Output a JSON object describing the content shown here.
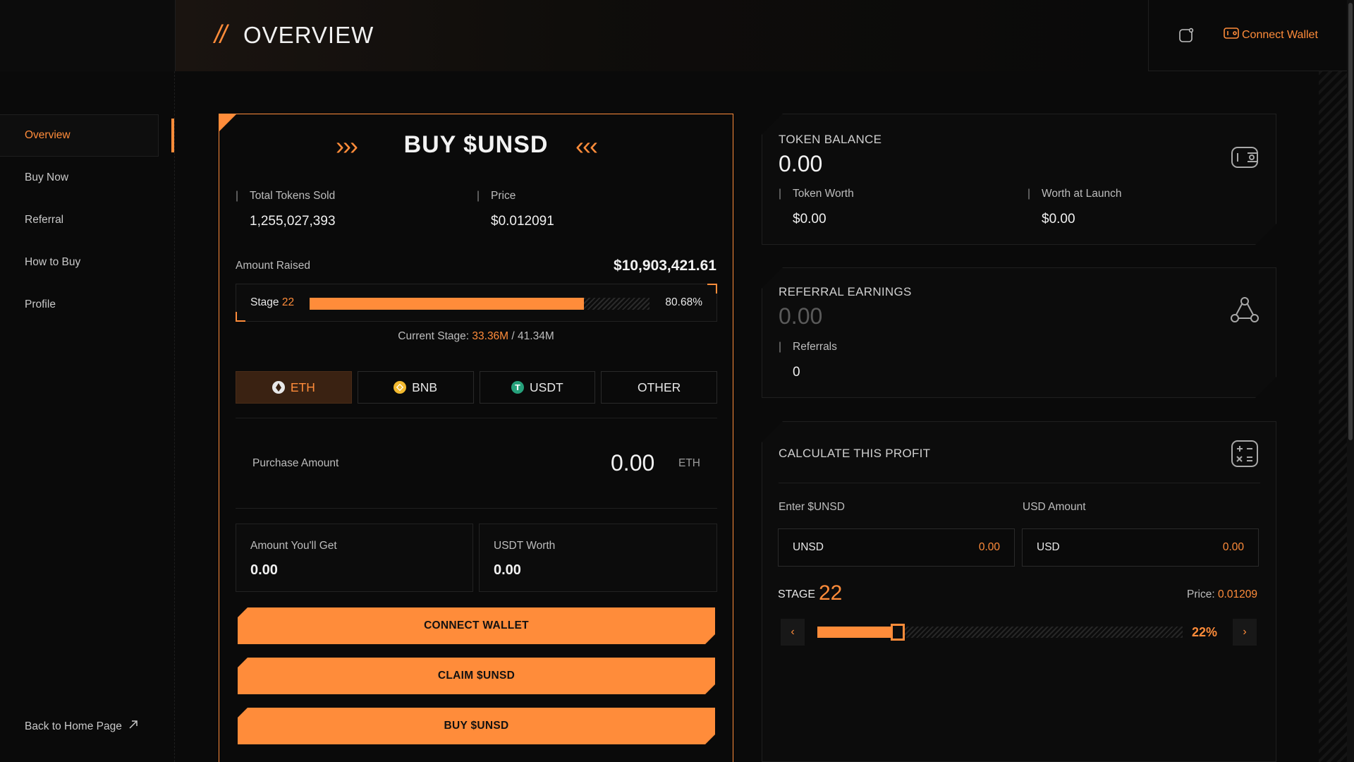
{
  "header": {
    "title_prefix": "//",
    "title": "OVERVIEW",
    "connect_wallet": "Connect Wallet"
  },
  "sidebar": {
    "items": [
      {
        "label": "Overview"
      },
      {
        "label": "Buy Now"
      },
      {
        "label": "Referral"
      },
      {
        "label": "How to Buy"
      },
      {
        "label": "Profile"
      }
    ],
    "back_home": "Back to Home Page"
  },
  "buy": {
    "title": "BUY $UNSD",
    "chevrons_left": "›››",
    "chevrons_right": "‹‹‹",
    "total_sold_label": "Total Tokens Sold",
    "total_sold_value": "1,255,027,393",
    "price_label": "Price",
    "price_value": "$0.012091",
    "amount_raised_label": "Amount Raised",
    "amount_raised_value": "$10,903,421.61",
    "stage_label": "Stage",
    "stage_number": "22",
    "stage_progress": 0.8068,
    "stage_percent": "80.68%",
    "current_stage_label": "Current Stage:",
    "current_stage_done": "33.36M",
    "current_stage_sep": "/",
    "current_stage_total": "41.34M",
    "currencies": [
      {
        "label": "ETH",
        "color": "#e8e8e8"
      },
      {
        "label": "BNB",
        "color": "#f3ba2f"
      },
      {
        "label": "USDT",
        "color": "#26a17b"
      },
      {
        "label": "OTHER",
        "color": ""
      }
    ],
    "purchase_label": "Purchase Amount",
    "purchase_value": "0.00",
    "purchase_unit": "ETH",
    "amount_get_label": "Amount You'll Get",
    "amount_get_value": "0.00",
    "usdt_worth_label": "USDT Worth",
    "usdt_worth_value": "0.00",
    "connect_button": "CONNECT WALLET",
    "claim_button": "CLAIM $UNSD",
    "buy_button": "BUY $UNSD"
  },
  "token_balance": {
    "title": "TOKEN BALANCE",
    "value": "0.00",
    "worth_label": "Token Worth",
    "worth_value": "$0.00",
    "launch_label": "Worth at Launch",
    "launch_value": "$0.00"
  },
  "referral": {
    "title": "REFERRAL EARNINGS",
    "value": "0.00",
    "count_label": "Referrals",
    "count_value": "0"
  },
  "calculator": {
    "title": "CALCULATE THIS PROFIT",
    "enter_label": "Enter $UNSD",
    "usd_label": "USD Amount",
    "unsd_key": "UNSD",
    "unsd_value": "0.00",
    "usd_key": "USD",
    "usd_value": "0.00",
    "stage_label": "STAGE",
    "stage_value": "22",
    "price_label": "Price:",
    "price_value": "0.01209",
    "slider_level": 0.22,
    "slider_percent": "22%",
    "prev": "‹",
    "next": "›"
  },
  "colors": {
    "accent": "#ff8c3a",
    "background": "#0a0a0a"
  }
}
